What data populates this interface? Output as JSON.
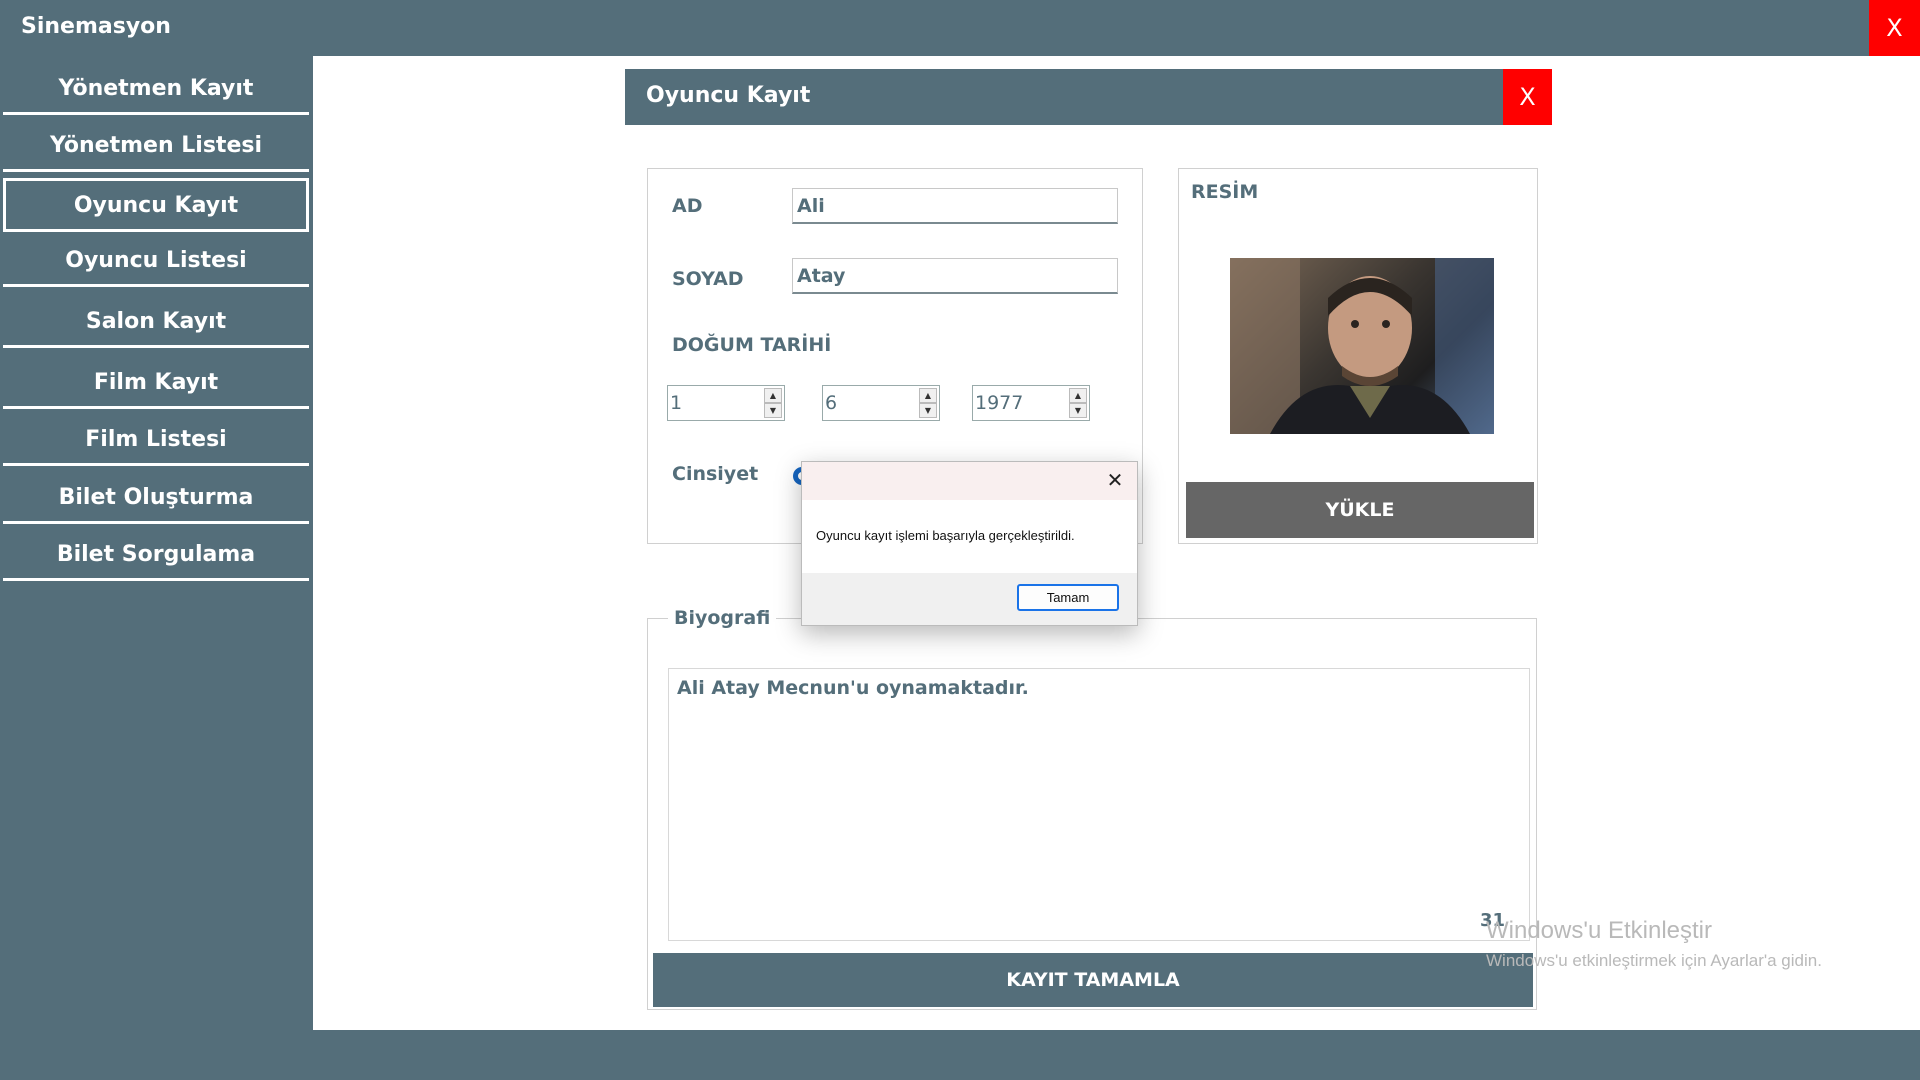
{
  "app": {
    "title": "Sinemasyon",
    "close_label": "X"
  },
  "sidebar": {
    "items": [
      {
        "label": "Yönetmen Kayıt"
      },
      {
        "label": "Yönetmen Listesi"
      },
      {
        "label": "Oyuncu Kayıt",
        "active": true
      },
      {
        "label": "Oyuncu Listesi"
      },
      {
        "label": "Salon Kayıt"
      },
      {
        "label": "Film Kayıt"
      },
      {
        "label": "Film Listesi"
      },
      {
        "label": "Bilet Oluşturma"
      },
      {
        "label": "Bilet Sorgulama"
      }
    ]
  },
  "form": {
    "title": "Oyuncu Kayıt",
    "close_label": "X",
    "ad_label": "AD",
    "ad_value": "Ali",
    "soyad_label": "SOYAD",
    "soyad_value": "Atay",
    "birth_label": "DOĞUM TARİHİ",
    "day": "1",
    "month": "6",
    "year": "1977",
    "gender_label": "Cinsiyet",
    "image_label": "RESİM",
    "upload_label": "YÜKLE",
    "bio_label": "Biyografi",
    "bio_text": "Ali Atay Mecnun'u oynamaktadır.",
    "bio_count": "31",
    "submit_label": "KAYIT TAMAMLA"
  },
  "dialog": {
    "message": "Oyuncu kayıt işlemi başarıyla gerçekleştirildi.",
    "ok_label": "Tamam"
  },
  "watermark": {
    "line1": "Windows'u Etkinleştir",
    "line2": "Windows'u etkinleştirmek için Ayarlar'a gidin."
  },
  "colors": {
    "primary": "#546e7a",
    "close": "#ff0000",
    "upload": "#666666"
  }
}
